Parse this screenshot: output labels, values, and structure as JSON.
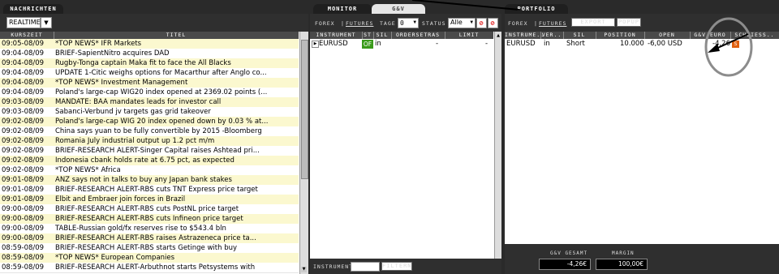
{
  "tabs": {
    "news": "NACHRICHTEN",
    "monitor": "MONITOR",
    "gv": "G&V",
    "portfolio": "PORTFOLIO"
  },
  "news": {
    "filter": "REALTIME",
    "col_time": "KURSZEIT",
    "col_title": "TITEL",
    "rows": [
      {
        "time": "09:05-08/09",
        "title": "*TOP NEWS* IFR Markets",
        "hl": true
      },
      {
        "time": "09:04-08/09",
        "title": "BRIEF-SapientNitro acquires DAD",
        "hl": false
      },
      {
        "time": "09:04-08/09",
        "title": "Rugby-Tonga captain Maka fit to face the All Blacks",
        "hl": true
      },
      {
        "time": "09:04-08/09",
        "title": "UPDATE 1-Citic weighs options for Macarthur after Anglo co...",
        "hl": false
      },
      {
        "time": "09:04-08/09",
        "title": "*TOP NEWS* Investment Management",
        "hl": true
      },
      {
        "time": "09:04-08/09",
        "title": "Poland's large-cap WIG20 index opened at 2369.02 points (...",
        "hl": false
      },
      {
        "time": "09:03-08/09",
        "title": "MANDATE: BAA mandates leads for investor call",
        "hl": true
      },
      {
        "time": "09:03-08/09",
        "title": "Sabanci-Verbund jv targets gas grid takeover",
        "hl": false
      },
      {
        "time": "09:02-08/09",
        "title": "Poland's large-cap WIG 20 index opened down by 0.03 % at...",
        "hl": true
      },
      {
        "time": "09:02-08/09",
        "title": "China says yuan to be fully convertible by 2015 -Bloomberg",
        "hl": false
      },
      {
        "time": "09:02-08/09",
        "title": " Romania July industrial output up 1.2 pct m/m",
        "hl": true
      },
      {
        "time": "09:02-08/09",
        "title": "BRIEF-RESEARCH ALERT-Singer Capital raises Ashtead pri...",
        "hl": false
      },
      {
        "time": "09:02-08/09",
        "title": "Indonesia cbank holds rate at 6.75 pct, as expected",
        "hl": true
      },
      {
        "time": "09:02-08/09",
        "title": "*TOP NEWS* Africa",
        "hl": false
      },
      {
        "time": "09:01-08/09",
        "title": " ANZ says not in talks to buy any Japan bank stakes",
        "hl": true
      },
      {
        "time": "09:01-08/09",
        "title": "BRIEF-RESEARCH ALERT-RBS cuts TNT Express price target",
        "hl": false
      },
      {
        "time": "09:01-08/09",
        "title": "Elbit and Embraer join forces in Brazil",
        "hl": true
      },
      {
        "time": "09:00-08/09",
        "title": "BRIEF-RESEARCH ALERT-RBS cuts PostNL price target",
        "hl": false
      },
      {
        "time": "09:00-08/09",
        "title": "BRIEF-RESEARCH ALERT-RBS cuts Infineon price target",
        "hl": true
      },
      {
        "time": "09:00-08/09",
        "title": "TABLE-Russian gold/fx reserves rise to $543.4 bln",
        "hl": false
      },
      {
        "time": "09:00-08/09",
        "title": "BRIEF-RESEARCH ALERT-RBS raises Astrazeneca price ta...",
        "hl": true
      },
      {
        "time": "08:59-08/09",
        "title": "BRIEF-RESEARCH ALERT-RBS starts Getinge with buy",
        "hl": false
      },
      {
        "time": "08:59-08/09",
        "title": "*TOP NEWS* European Companies",
        "hl": true
      },
      {
        "time": "08:59-08/09",
        "title": "BRIEF-RESEARCH ALERT-Arbuthnot starts Petsystems with",
        "hl": false
      }
    ]
  },
  "monitor": {
    "market_a": "FOREX",
    "market_b": "FUTURES",
    "tage_label": "TAGE",
    "tage_value": "0",
    "status_label": "STATUS",
    "status_value": "Alle",
    "cols": [
      "INSTRUMENT",
      "ST",
      "SIL",
      "ORDERSETRAS",
      "LIMIT"
    ],
    "row": {
      "instrument": "EURUSD",
      "status": "OF",
      "side": "in",
      "orders": "-",
      "limit": "-"
    },
    "instrument_label": "INSTRUMENT",
    "filter_button": "FILTERN"
  },
  "portfolio": {
    "market_a": "FOREX",
    "market_b": "FUTURES",
    "export_button": "EXPORT",
    "popup_button": "POPUP",
    "cols": [
      "INSTRUME..",
      "VER..",
      "SIL",
      "POSITION",
      "OPEN",
      "G&V EURO",
      "SCHLIESS.."
    ],
    "row": {
      "instrument": "EURUSD",
      "ver": "in",
      "side": "Short",
      "position": "10.000",
      "open": "-6,00 USD",
      "gv": "-4,26",
      "close": "S"
    },
    "total_label": "G&V GESAMT",
    "total_value": "-4,26€",
    "margin_label": "MARGIN",
    "margin_value": "100,00€"
  },
  "colors": {
    "highlight_row": "#fbf8cf",
    "status_green": "#3a9a1a",
    "close_orange": "#e06010",
    "dark_panel": "#2f2f2f"
  }
}
